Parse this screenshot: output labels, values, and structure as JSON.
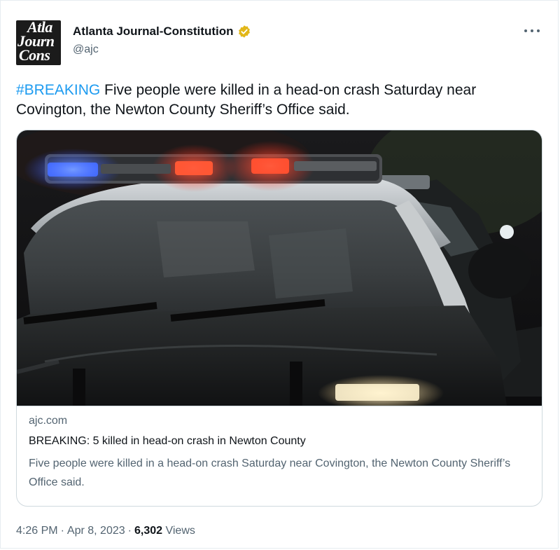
{
  "author": {
    "display_name": "Atlanta Journal-Constitution",
    "handle": "@ajc",
    "avatar_text": [
      "Atla",
      "Journ",
      "Cons"
    ],
    "verified_icon": "gold-verified-badge-icon"
  },
  "tweet": {
    "hashtag": "#BREAKING",
    "text": " Five people were killed in a head-on crash Saturday near Covington, the Newton County Sheriff’s Office said."
  },
  "card": {
    "image_alt": "police-car-with-lights-photo",
    "domain": "ajc.com",
    "title": "BREAKING: 5 killed in head-on crash in Newton County",
    "description": "Five people were killed in a head-on crash Saturday near Covington, the Newton County Sheriff’s Office said."
  },
  "footer": {
    "time": "4:26 PM",
    "date": "Apr 8, 2023",
    "views_count": "6,302",
    "views_label": "Views",
    "separator": "·"
  },
  "colors": {
    "link": "#1d9bf0",
    "secondary_text": "#536471",
    "primary_text": "#0f1419",
    "verified_gold": "#e2b719",
    "border": "#cfd9de"
  }
}
